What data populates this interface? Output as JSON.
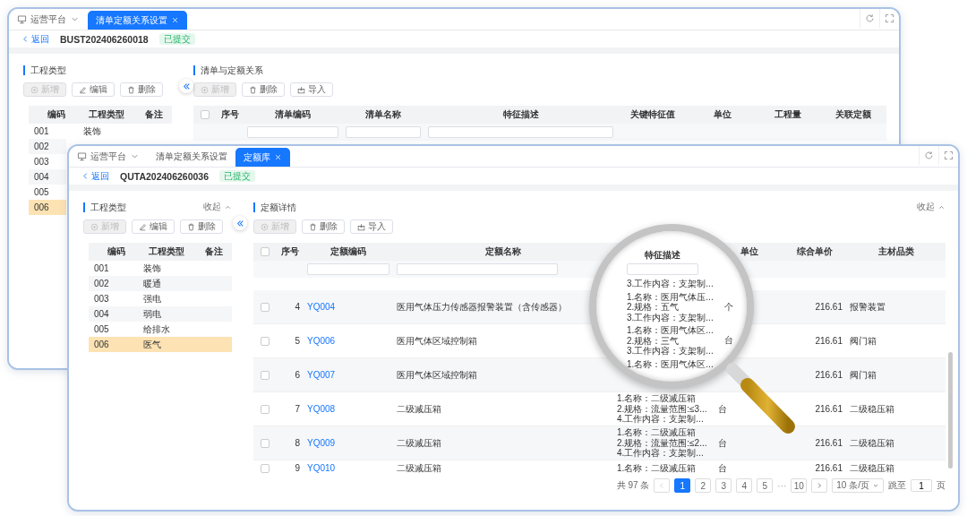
{
  "back_window": {
    "tabs": [
      {
        "label": "运营平台",
        "kind": "platform",
        "selected": false
      },
      {
        "label": "清单定额关系设置",
        "kind": "page",
        "selected": true
      }
    ],
    "back_link": "返回",
    "document_code": "BUST202406260018",
    "status_badge": "已提交",
    "left_panel": {
      "title": "工程类型",
      "buttons": [
        {
          "label": "新增",
          "kind": "add",
          "disabled": true
        },
        {
          "label": "编辑",
          "kind": "edit",
          "disabled": false
        },
        {
          "label": "删除",
          "kind": "delete",
          "disabled": false
        }
      ],
      "columns": [
        "编码",
        "工程类型",
        "备注"
      ],
      "rows": [
        {
          "code": "001",
          "type": "装饰",
          "selected": false
        },
        {
          "code": "002",
          "selected": false
        },
        {
          "code": "003",
          "selected": false
        },
        {
          "code": "004",
          "selected": false
        },
        {
          "code": "005",
          "selected": false
        },
        {
          "code": "006",
          "selected": true
        }
      ]
    },
    "right_panel": {
      "title": "清单与定额关系",
      "buttons": [
        {
          "label": "新增",
          "kind": "add",
          "disabled": true
        },
        {
          "label": "删除",
          "kind": "delete",
          "disabled": false
        },
        {
          "label": "导入",
          "kind": "import",
          "disabled": false
        }
      ],
      "header_checked": false,
      "columns": [
        {
          "label": "序号",
          "filter": false
        },
        {
          "label": "清单编码",
          "filter": true
        },
        {
          "label": "清单名称",
          "filter": true
        },
        {
          "label": "特征描述",
          "filter": true
        },
        {
          "label": "关键特征值",
          "filter": false
        },
        {
          "label": "单位",
          "filter": false
        },
        {
          "label": "工程量",
          "filter": false
        },
        {
          "label": "关联定额",
          "filter": false
        }
      ]
    }
  },
  "front_window": {
    "tabs": [
      {
        "label": "运营平台",
        "kind": "platform",
        "selected": false
      },
      {
        "label": "清单定额关系设置",
        "kind": "page",
        "selected": false
      },
      {
        "label": "定额库",
        "kind": "page",
        "selected": true
      }
    ],
    "back_link": "返回",
    "document_code": "QUTA202406260036",
    "status_badge": "已提交",
    "left_panel": {
      "title": "工程类型",
      "collapse_label": "收起",
      "buttons": [
        {
          "label": "新增",
          "kind": "add",
          "disabled": true
        },
        {
          "label": "编辑",
          "kind": "edit",
          "disabled": false
        },
        {
          "label": "删除",
          "kind": "delete",
          "disabled": false
        }
      ],
      "columns": [
        "编码",
        "工程类型",
        "备注"
      ],
      "rows": [
        {
          "code": "001",
          "type": "装饰",
          "selected": false
        },
        {
          "code": "002",
          "type": "暖通",
          "selected": false
        },
        {
          "code": "003",
          "type": "强电",
          "selected": false
        },
        {
          "code": "004",
          "type": "弱电",
          "selected": false
        },
        {
          "code": "005",
          "type": "给排水",
          "selected": false
        },
        {
          "code": "006",
          "type": "医气",
          "selected": true
        }
      ]
    },
    "right_panel": {
      "title": "定额详情",
      "collapse_label": "收起",
      "buttons": [
        {
          "label": "新增",
          "kind": "add",
          "disabled": true
        },
        {
          "label": "删除",
          "kind": "delete",
          "disabled": false
        },
        {
          "label": "导入",
          "kind": "import",
          "disabled": false
        }
      ],
      "header_checked": false,
      "columns": [
        {
          "label": "序号",
          "filter": false
        },
        {
          "label": "定额编码",
          "filter": true
        },
        {
          "label": "定额名称",
          "filter": true
        },
        {
          "label": "单位",
          "filter": false
        },
        {
          "label": "综合单价",
          "filter": false
        },
        {
          "label": "主材品类",
          "filter": false
        }
      ],
      "rows": [
        {
          "index": "4",
          "code": "YQ004",
          "name": "医用气体压力传感器报警装置（含传感器）",
          "price": "216.61",
          "category": "报警装置",
          "checked": false
        },
        {
          "index": "5",
          "code": "YQ006",
          "name": "医用气体区域控制箱",
          "price": "216.61",
          "category": "阀门箱",
          "checked": false
        },
        {
          "index": "6",
          "code": "YQ007",
          "name": "医用气体区域控制箱",
          "price": "216.61",
          "category": "阀门箱",
          "checked": false
        },
        {
          "index": "7",
          "code": "YQ008",
          "name": "二级减压箱",
          "features": [
            "1.名称：二级减压箱",
            "2.规格：流量范围:≤3...",
            "4.工作内容：支架制..."
          ],
          "unit": "台",
          "price": "216.61",
          "category": "二级稳压箱",
          "checked": false
        },
        {
          "index": "8",
          "code": "YQ009",
          "name": "二级减压箱",
          "features": [
            "1.名称：二级减压箱",
            "2.规格：流量范围:≤2...",
            "4.工作内容：支架制..."
          ],
          "unit": "台",
          "price": "216.61",
          "category": "二级稳压箱",
          "checked": false
        },
        {
          "index": "9",
          "code": "YQ010",
          "name": "二级减压箱",
          "features": [
            "1.名称：二级减压箱"
          ],
          "unit": "台",
          "price": "216.61",
          "category": "二级稳压箱",
          "checked": false
        }
      ]
    },
    "magnifier": {
      "column_header": "特征描述",
      "groups": [
        {
          "lines": [
            "3.工作内容：支架制..."
          ]
        },
        {
          "lines": [
            "1.名称：医用气体压...",
            "2.规格：五气",
            "3.工作内容：支架制..."
          ],
          "unit": "个"
        },
        {
          "lines": [
            "1.名称：医用气体区...",
            "2.规格：三气",
            "3.工作内容：支架制..."
          ],
          "unit": "台"
        },
        {
          "lines": [
            "1.名称：医用气体区..."
          ]
        }
      ]
    },
    "pagination": {
      "total": "共 97 条",
      "pages": [
        {
          "label": "1",
          "kind": "page",
          "selected": true
        },
        {
          "label": "2",
          "kind": "page",
          "selected": false
        },
        {
          "label": "3",
          "kind": "page",
          "selected": false
        },
        {
          "label": "4",
          "kind": "page",
          "selected": false
        },
        {
          "label": "5",
          "kind": "page",
          "selected": false
        },
        {
          "label": "···",
          "kind": "ellipsis"
        },
        {
          "label": "10",
          "kind": "page",
          "selected": false
        }
      ],
      "page_size": "10 条/页",
      "jump_label": "跳至",
      "jump_value": "1",
      "page_suffix": "页"
    }
  }
}
